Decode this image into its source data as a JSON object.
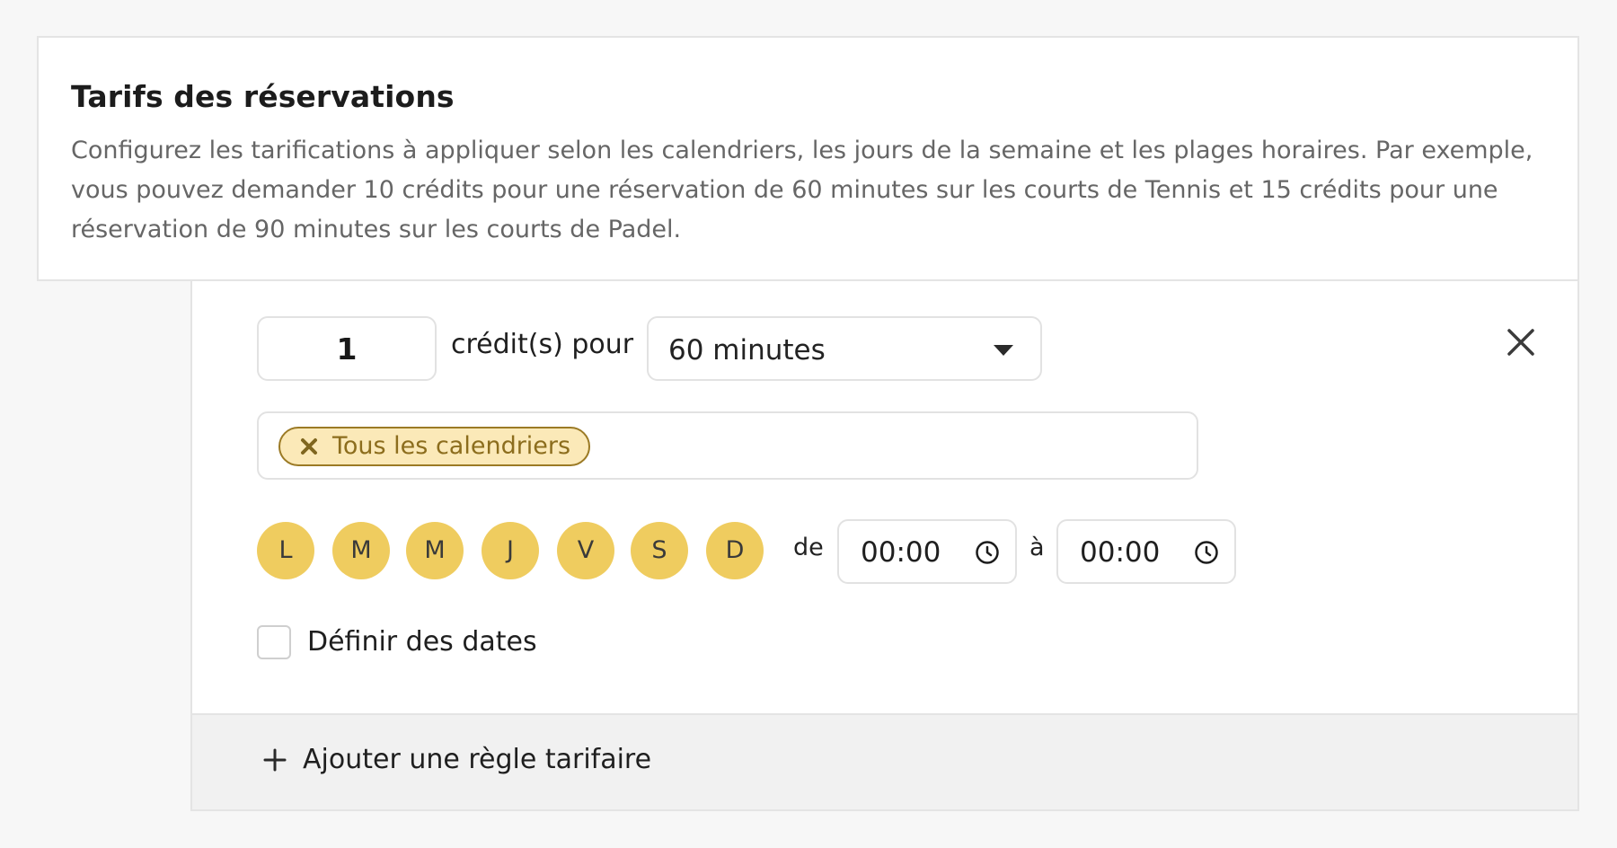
{
  "header": {
    "title": "Tarifs des réservations",
    "description": "Configurez les tarifications à appliquer selon les calendriers, les jours de la semaine et les plages horaires. Par exemple, vous pouvez demander 10 crédits pour une réservation de 60 minutes sur les courts de Tennis et 15 crédits pour une réservation de 90 minutes sur les courts de Padel."
  },
  "rule": {
    "credits_value": "1",
    "credits_label": "crédit(s) pour",
    "duration_value": "60 minutes",
    "calendar_tag": "Tous les calendriers",
    "days": [
      "L",
      "M",
      "M",
      "J",
      "V",
      "S",
      "D"
    ],
    "time_from_label": "de",
    "time_from_value": "00:00",
    "time_to_label": "à",
    "time_to_value": "00:00",
    "define_dates_label": "Définir des dates"
  },
  "footer": {
    "add_rule_label": "Ajouter une règle tarifaire"
  },
  "icons": {
    "dropdown": "chevron-down-icon",
    "close": "close-icon",
    "tag_close": "tag-close-icon",
    "clock": "clock-icon",
    "plus": "plus-icon"
  },
  "colors": {
    "day_active": "#efcc5f",
    "tag_background": "#fbe9b8",
    "tag_border": "#9b7a25",
    "panel_border": "#e4e4e4",
    "footer_background": "#f1f1f1"
  }
}
